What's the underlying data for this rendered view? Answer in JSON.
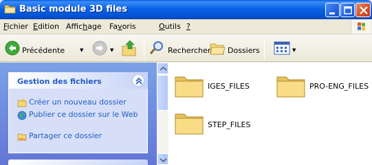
{
  "window": {
    "title": "Basic module 3D files",
    "title_icon": "folder-icon"
  },
  "menu": {
    "items": [
      {
        "pre": "",
        "key": "F",
        "post": "ichier"
      },
      {
        "pre": "",
        "key": "E",
        "post": "dition"
      },
      {
        "pre": "Affic",
        "key": "h",
        "post": "age"
      },
      {
        "pre": "Fa",
        "key": "v",
        "post": "oris"
      },
      {
        "pre": "",
        "key": "O",
        "post": "utils"
      },
      {
        "pre": "",
        "key": "?",
        "post": ""
      }
    ]
  },
  "toolbar": {
    "back_label": "Précédente",
    "search_label": "Rechercher",
    "folders_label": "Dossiers"
  },
  "taskpane": {
    "title": "Gestion des fichiers",
    "links": [
      {
        "label": "Créer un nouveau dossier",
        "icon": "new-folder-icon"
      },
      {
        "label": "Publier ce dossier sur le Web",
        "icon": "globe-icon"
      },
      {
        "label": "Partager ce dossier",
        "icon": "share-folder-icon"
      }
    ]
  },
  "content": {
    "folders": [
      "IGES_FILES",
      "PRO-ENG_FILES",
      "STEP_FILES"
    ]
  },
  "colors": {
    "titlebar": "#0a62e8",
    "taskpane_link": "#215dc6",
    "folder": "#f5d77a"
  }
}
